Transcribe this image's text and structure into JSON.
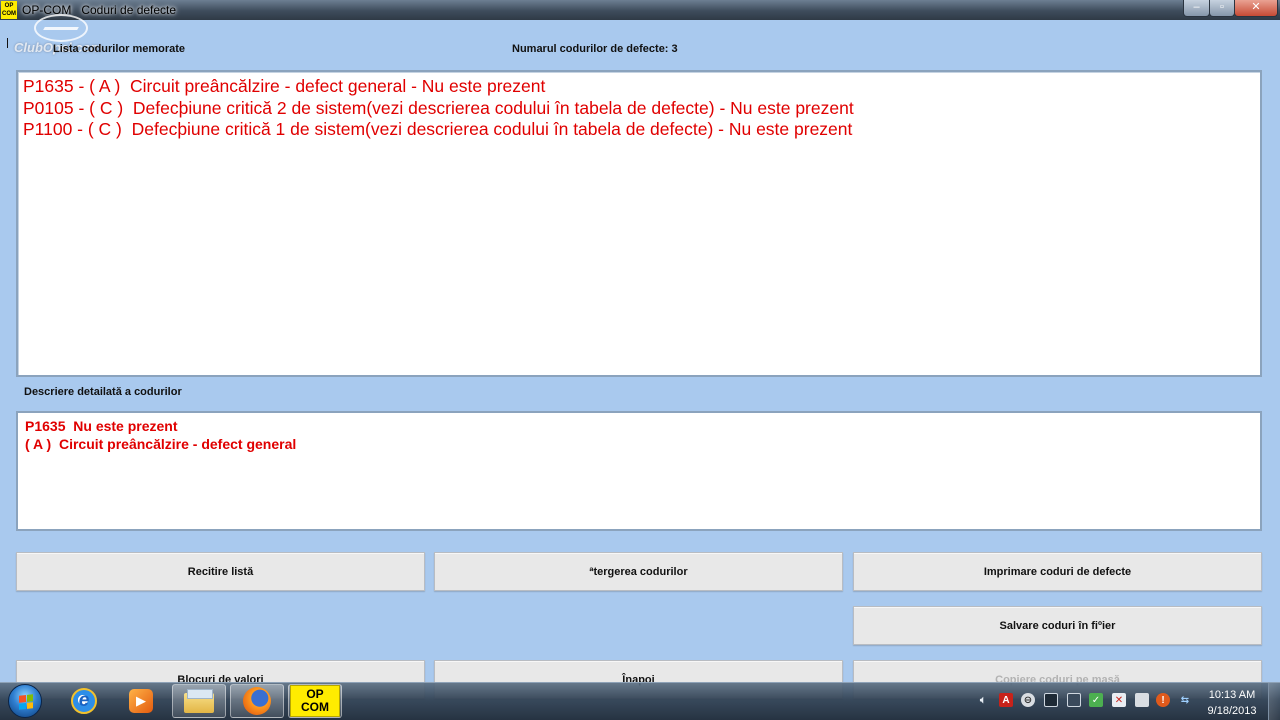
{
  "window": {
    "icon_text_line1": "OP",
    "icon_text_line2": "COM",
    "title": "OP-COM   Coduri de defecte",
    "controls": {
      "minimize": "–",
      "maximize": "▫",
      "close": "✕"
    }
  },
  "watermark": "ClubOpel.com",
  "header": {
    "list_label": "Lista codurilor memorate",
    "count_label": "Numarul codurilor de defecte: 3"
  },
  "codes": [
    "P1635 - ( A )  Circuit preâncălzire - defect general - Nu este prezent",
    "P0105 - ( C )  Defecþiune critică 2 de sistem(vezi descrierea codului în tabela de defecte) - Nu este prezent",
    "P1100 - ( C )  Defecþiune critică 1 de sistem(vezi descrierea codului în tabela de defecte) - Nu este prezent"
  ],
  "detail": {
    "label": "Descriere detailată a codurilor",
    "lines": [
      "P1635  Nu este prezent",
      "( A )  Circuit preâncălzire - defect general"
    ]
  },
  "buttons": {
    "reread": "Recitire listă",
    "clear": "ªtergerea codurilor",
    "print": "Imprimare coduri de defecte",
    "save": "Salvare coduri în fiºier",
    "value_blocks": "Blocuri de valori",
    "back": "Înapoi",
    "copy_clipboard": "Copiere coduri pe masă"
  },
  "taskbar": {
    "opcom_line1": "OP",
    "opcom_line2": "COM",
    "time": "10:13 AM",
    "date": "9/18/2013"
  },
  "colors": {
    "window_bg": "#a9c9ee",
    "code_text": "#e00000",
    "opcom_yellow": "#ffec00"
  }
}
